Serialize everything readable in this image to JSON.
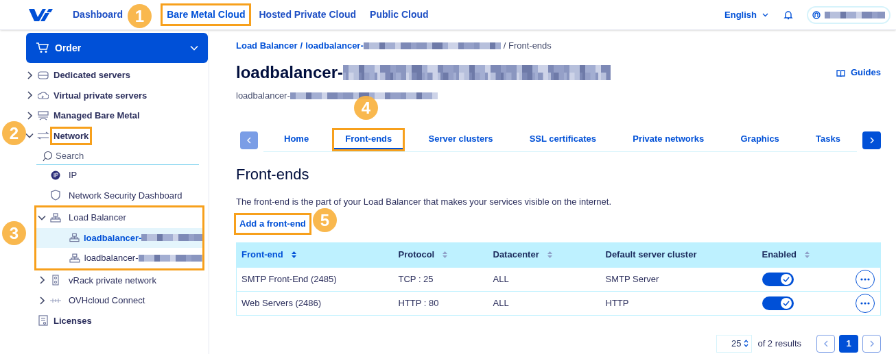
{
  "top_nav": {
    "items": [
      {
        "label": "Dashboard",
        "selected": false,
        "highlighted": false
      },
      {
        "label": "Bare Metal Cloud",
        "selected": true,
        "highlighted": true
      },
      {
        "label": "Hosted Private Cloud",
        "selected": false,
        "highlighted": false
      },
      {
        "label": "Public Cloud",
        "selected": false,
        "highlighted": false
      }
    ],
    "language": "English"
  },
  "sidebar": {
    "order_button": "Order",
    "items": [
      {
        "label": "Dedicated servers",
        "expanded": false,
        "highlighted": false
      },
      {
        "label": "Virtual private servers",
        "expanded": false,
        "highlighted": false
      },
      {
        "label": "Managed Bare Metal",
        "expanded": false,
        "highlighted": false
      },
      {
        "label": "Network",
        "expanded": true,
        "highlighted": true,
        "search_placeholder": "Search",
        "children": [
          {
            "label": "IP"
          },
          {
            "label": "Network Security Dashboard"
          },
          {
            "label": "Load Balancer",
            "expanded": true,
            "highlighted": true,
            "children": [
              {
                "label": "loadbalancer-",
                "selected": true
              },
              {
                "label": "loadbalancer-",
                "selected": false
              }
            ]
          },
          {
            "label": "vRack private network",
            "expanded": false
          },
          {
            "label": "OVHcloud Connect",
            "expanded": false
          }
        ]
      },
      {
        "label": "Licenses",
        "highlighted": false
      }
    ]
  },
  "breadcrumb": [
    "Load Balancer",
    "/",
    "loadbalancer-",
    "/ Front-ends"
  ],
  "title": "loadbalancer-",
  "subtitle": "loadbalancer-",
  "guides_link": "Guides",
  "tabs": [
    {
      "label": "Home",
      "selected": false,
      "highlighted": false
    },
    {
      "label": "Front-ends",
      "selected": true,
      "highlighted": true
    },
    {
      "label": "Server clusters",
      "selected": false,
      "highlighted": false
    },
    {
      "label": "SSL certificates",
      "selected": false,
      "highlighted": false
    },
    {
      "label": "Private networks",
      "selected": false,
      "highlighted": false
    },
    {
      "label": "Graphics",
      "selected": false,
      "highlighted": false
    },
    {
      "label": "Tasks",
      "selected": false,
      "highlighted": false
    }
  ],
  "section_title": "Front-ends",
  "description": "The front-end is the part of your Load Balancer that makes your services visible on the internet.",
  "add_link": {
    "label": "Add a front-end",
    "highlighted": true
  },
  "table": {
    "columns": [
      {
        "label": "Front-end",
        "sortable": true,
        "selected": true
      },
      {
        "label": "Protocol",
        "sortable": true,
        "selected": false
      },
      {
        "label": "Datacenter",
        "sortable": true,
        "selected": false
      },
      {
        "label": "Default server cluster",
        "sortable": false,
        "selected": false
      },
      {
        "label": "Enabled",
        "sortable": true,
        "selected": false
      }
    ],
    "rows": [
      {
        "cells": [
          "SMTP Front-End (2485)",
          "TCP : 25",
          "ALL",
          "SMTP Server"
        ],
        "enabled": true
      },
      {
        "cells": [
          "Web Servers (2486)",
          "HTTP : 80",
          "ALL",
          "HTTP"
        ],
        "enabled": true
      }
    ]
  },
  "pagination": {
    "page_size": "25",
    "results": "of 2 results",
    "pages": [
      {
        "label": "1",
        "selected": true
      }
    ]
  },
  "callouts": [
    "1",
    "2",
    "3",
    "4",
    "5"
  ]
}
